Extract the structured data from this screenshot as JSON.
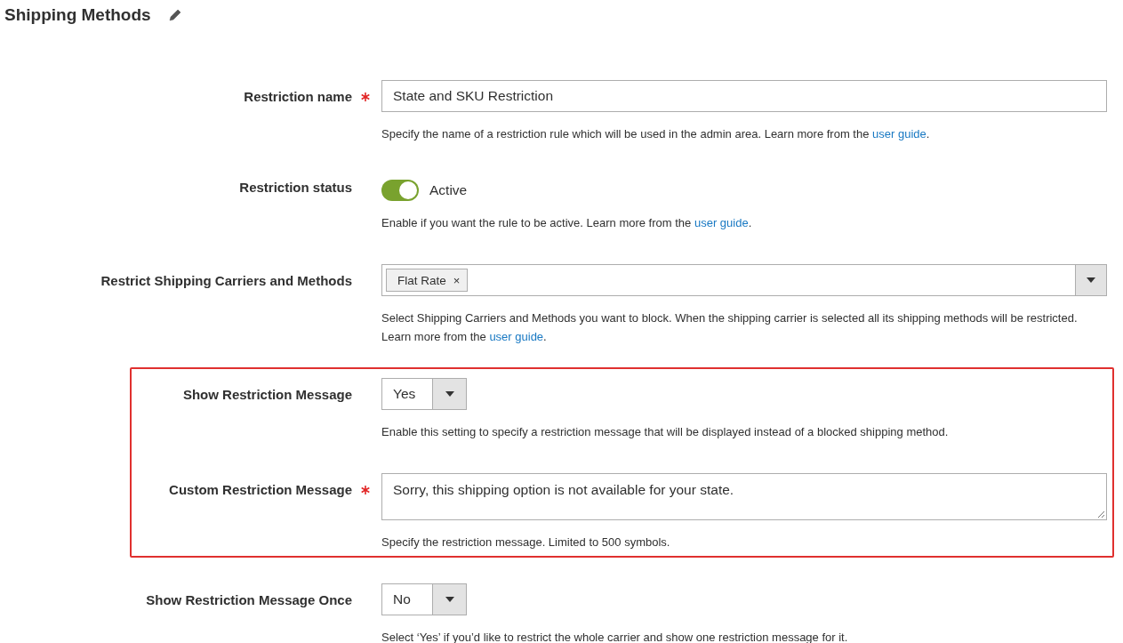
{
  "title": "Shipping Methods",
  "fields": [
    {
      "kind": "text",
      "label": "Restriction name",
      "required": true,
      "highlighted": false,
      "value": "State and SKU Restriction",
      "note": {
        "before": "Specify the name of a restriction rule which will be used in the admin area. Learn more from the ",
        "link": "user guide",
        "after": "."
      }
    },
    {
      "kind": "toggle",
      "label": "Restriction status",
      "required": false,
      "highlighted": false,
      "on": true,
      "state_label": "Active",
      "note": {
        "before": "Enable if you want the rule to be active. Learn more from the ",
        "link": "user guide",
        "after": "."
      }
    },
    {
      "kind": "multiselect",
      "label": "Restrict Shipping Carriers and Methods",
      "required": false,
      "highlighted": false,
      "tags": [
        {
          "label": "Flat Rate",
          "remove": "×"
        }
      ],
      "note": {
        "before": "Select Shipping Carriers and Methods you want to block. When the shipping carrier is selected all its shipping methods will be restricted. Learn more from the ",
        "link": "user guide",
        "after": "."
      }
    },
    {
      "kind": "select",
      "label": "Show Restriction Message",
      "required": false,
      "highlighted": true,
      "value": "Yes",
      "note": {
        "before": "Enable this setting to specify a restriction message that will be displayed instead of a blocked shipping method."
      }
    },
    {
      "kind": "textarea",
      "label": "Custom Restriction Message",
      "required": true,
      "highlighted": true,
      "value": "Sorry, this shipping option is not available for your state.",
      "note": {
        "before": "Specify the restriction message. Limited to 500 symbols."
      }
    },
    {
      "kind": "select",
      "label": "Show Restriction Message Once",
      "required": false,
      "highlighted": false,
      "value": "No",
      "note": {
        "before": "Select ‘Yes’ if you’d like to restrict the whole carrier and show one restriction message for it."
      }
    }
  ]
}
